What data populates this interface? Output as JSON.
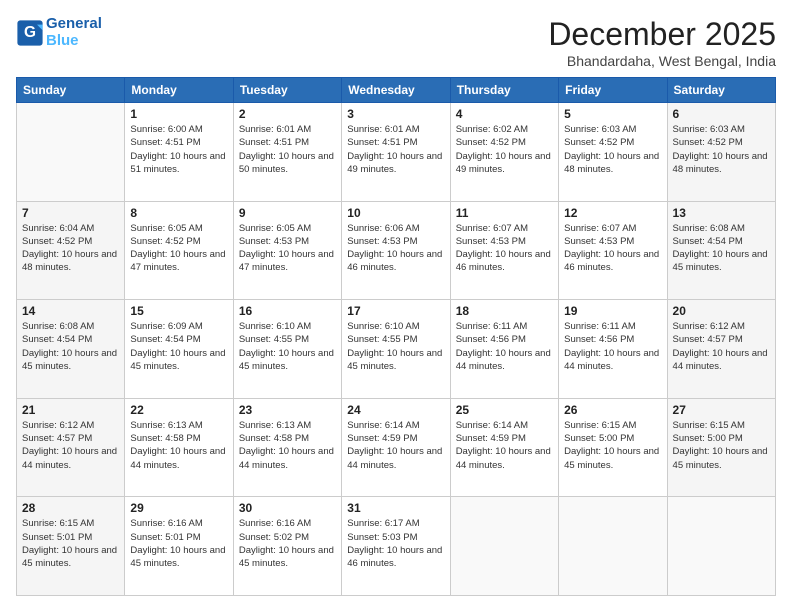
{
  "header": {
    "logo_line1": "General",
    "logo_line2": "Blue",
    "title": "December 2025",
    "location": "Bhandardaha, West Bengal, India"
  },
  "columns": [
    "Sunday",
    "Monday",
    "Tuesday",
    "Wednesday",
    "Thursday",
    "Friday",
    "Saturday"
  ],
  "weeks": [
    [
      {
        "day": "",
        "sunrise": "",
        "sunset": "",
        "daylight": "",
        "empty": true
      },
      {
        "day": "1",
        "sunrise": "Sunrise: 6:00 AM",
        "sunset": "Sunset: 4:51 PM",
        "daylight": "Daylight: 10 hours and 51 minutes."
      },
      {
        "day": "2",
        "sunrise": "Sunrise: 6:01 AM",
        "sunset": "Sunset: 4:51 PM",
        "daylight": "Daylight: 10 hours and 50 minutes."
      },
      {
        "day": "3",
        "sunrise": "Sunrise: 6:01 AM",
        "sunset": "Sunset: 4:51 PM",
        "daylight": "Daylight: 10 hours and 49 minutes."
      },
      {
        "day": "4",
        "sunrise": "Sunrise: 6:02 AM",
        "sunset": "Sunset: 4:52 PM",
        "daylight": "Daylight: 10 hours and 49 minutes."
      },
      {
        "day": "5",
        "sunrise": "Sunrise: 6:03 AM",
        "sunset": "Sunset: 4:52 PM",
        "daylight": "Daylight: 10 hours and 48 minutes."
      },
      {
        "day": "6",
        "sunrise": "Sunrise: 6:03 AM",
        "sunset": "Sunset: 4:52 PM",
        "daylight": "Daylight: 10 hours and 48 minutes."
      }
    ],
    [
      {
        "day": "7",
        "sunrise": "Sunrise: 6:04 AM",
        "sunset": "Sunset: 4:52 PM",
        "daylight": "Daylight: 10 hours and 48 minutes."
      },
      {
        "day": "8",
        "sunrise": "Sunrise: 6:05 AM",
        "sunset": "Sunset: 4:52 PM",
        "daylight": "Daylight: 10 hours and 47 minutes."
      },
      {
        "day": "9",
        "sunrise": "Sunrise: 6:05 AM",
        "sunset": "Sunset: 4:53 PM",
        "daylight": "Daylight: 10 hours and 47 minutes."
      },
      {
        "day": "10",
        "sunrise": "Sunrise: 6:06 AM",
        "sunset": "Sunset: 4:53 PM",
        "daylight": "Daylight: 10 hours and 46 minutes."
      },
      {
        "day": "11",
        "sunrise": "Sunrise: 6:07 AM",
        "sunset": "Sunset: 4:53 PM",
        "daylight": "Daylight: 10 hours and 46 minutes."
      },
      {
        "day": "12",
        "sunrise": "Sunrise: 6:07 AM",
        "sunset": "Sunset: 4:53 PM",
        "daylight": "Daylight: 10 hours and 46 minutes."
      },
      {
        "day": "13",
        "sunrise": "Sunrise: 6:08 AM",
        "sunset": "Sunset: 4:54 PM",
        "daylight": "Daylight: 10 hours and 45 minutes."
      }
    ],
    [
      {
        "day": "14",
        "sunrise": "Sunrise: 6:08 AM",
        "sunset": "Sunset: 4:54 PM",
        "daylight": "Daylight: 10 hours and 45 minutes."
      },
      {
        "day": "15",
        "sunrise": "Sunrise: 6:09 AM",
        "sunset": "Sunset: 4:54 PM",
        "daylight": "Daylight: 10 hours and 45 minutes."
      },
      {
        "day": "16",
        "sunrise": "Sunrise: 6:10 AM",
        "sunset": "Sunset: 4:55 PM",
        "daylight": "Daylight: 10 hours and 45 minutes."
      },
      {
        "day": "17",
        "sunrise": "Sunrise: 6:10 AM",
        "sunset": "Sunset: 4:55 PM",
        "daylight": "Daylight: 10 hours and 45 minutes."
      },
      {
        "day": "18",
        "sunrise": "Sunrise: 6:11 AM",
        "sunset": "Sunset: 4:56 PM",
        "daylight": "Daylight: 10 hours and 44 minutes."
      },
      {
        "day": "19",
        "sunrise": "Sunrise: 6:11 AM",
        "sunset": "Sunset: 4:56 PM",
        "daylight": "Daylight: 10 hours and 44 minutes."
      },
      {
        "day": "20",
        "sunrise": "Sunrise: 6:12 AM",
        "sunset": "Sunset: 4:57 PM",
        "daylight": "Daylight: 10 hours and 44 minutes."
      }
    ],
    [
      {
        "day": "21",
        "sunrise": "Sunrise: 6:12 AM",
        "sunset": "Sunset: 4:57 PM",
        "daylight": "Daylight: 10 hours and 44 minutes."
      },
      {
        "day": "22",
        "sunrise": "Sunrise: 6:13 AM",
        "sunset": "Sunset: 4:58 PM",
        "daylight": "Daylight: 10 hours and 44 minutes."
      },
      {
        "day": "23",
        "sunrise": "Sunrise: 6:13 AM",
        "sunset": "Sunset: 4:58 PM",
        "daylight": "Daylight: 10 hours and 44 minutes."
      },
      {
        "day": "24",
        "sunrise": "Sunrise: 6:14 AM",
        "sunset": "Sunset: 4:59 PM",
        "daylight": "Daylight: 10 hours and 44 minutes."
      },
      {
        "day": "25",
        "sunrise": "Sunrise: 6:14 AM",
        "sunset": "Sunset: 4:59 PM",
        "daylight": "Daylight: 10 hours and 44 minutes."
      },
      {
        "day": "26",
        "sunrise": "Sunrise: 6:15 AM",
        "sunset": "Sunset: 5:00 PM",
        "daylight": "Daylight: 10 hours and 45 minutes."
      },
      {
        "day": "27",
        "sunrise": "Sunrise: 6:15 AM",
        "sunset": "Sunset: 5:00 PM",
        "daylight": "Daylight: 10 hours and 45 minutes."
      }
    ],
    [
      {
        "day": "28",
        "sunrise": "Sunrise: 6:15 AM",
        "sunset": "Sunset: 5:01 PM",
        "daylight": "Daylight: 10 hours and 45 minutes."
      },
      {
        "day": "29",
        "sunrise": "Sunrise: 6:16 AM",
        "sunset": "Sunset: 5:01 PM",
        "daylight": "Daylight: 10 hours and 45 minutes."
      },
      {
        "day": "30",
        "sunrise": "Sunrise: 6:16 AM",
        "sunset": "Sunset: 5:02 PM",
        "daylight": "Daylight: 10 hours and 45 minutes."
      },
      {
        "day": "31",
        "sunrise": "Sunrise: 6:17 AM",
        "sunset": "Sunset: 5:03 PM",
        "daylight": "Daylight: 10 hours and 46 minutes."
      },
      {
        "day": "",
        "sunrise": "",
        "sunset": "",
        "daylight": "",
        "empty": true
      },
      {
        "day": "",
        "sunrise": "",
        "sunset": "",
        "daylight": "",
        "empty": true
      },
      {
        "day": "",
        "sunrise": "",
        "sunset": "",
        "daylight": "",
        "empty": true
      }
    ]
  ]
}
